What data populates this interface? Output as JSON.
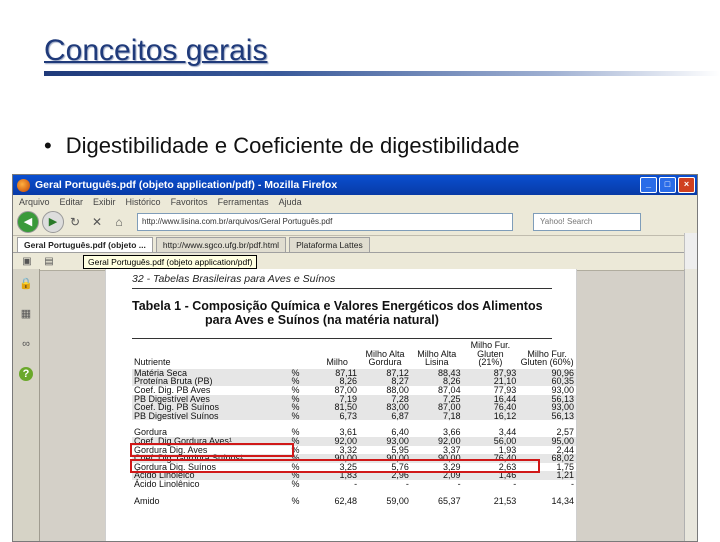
{
  "slide": {
    "title": "Conceitos gerais",
    "bullet": "Digestibilidade e Coeficiente de digestibilidade"
  },
  "browser": {
    "window_title": "Geral Português.pdf (objeto application/pdf) - Mozilla Firefox",
    "menu_items": [
      "Arquivo",
      "Editar",
      "Exibir",
      "Histórico",
      "Favoritos",
      "Ferramentas",
      "Ajuda"
    ],
    "url": "http://www.lisina.com.br/arquivos/Geral Português.pdf",
    "search_placeholder": "Yahoo! Search",
    "tabs": [
      {
        "label": "Geral Português.pdf (objeto ...",
        "active": true
      },
      {
        "label": "http://www.sgco.ufg.br/pdf.html",
        "active": false
      },
      {
        "label": "Plataforma Lattes",
        "active": false
      }
    ],
    "tooltip": "Geral Português.pdf (objeto application/pdf)"
  },
  "pdf": {
    "page_header": "32   -   Tabelas Brasileiras para Aves e Suínos",
    "caption_line1": "Tabela 1 -   Composição Química e Valores Energéticos dos Alimentos",
    "caption_line2": "para Aves e Suínos (na matéria natural)",
    "columns": [
      "Nutriente",
      "",
      "Milho",
      "Milho Alta Gordura",
      "Milho Alta Lisina",
      "Milho Fur. Gluten (21%)",
      "Milho Fur. Gluten (60%)"
    ],
    "rows": [
      {
        "name": "Matéria Seca",
        "unit": "%",
        "values": [
          "87,11",
          "87,12",
          "88,43",
          "87,93",
          "90,96"
        ],
        "shade": true
      },
      {
        "name": "Proteína Bruta (PB)",
        "unit": "%",
        "values": [
          "8,26",
          "8,27",
          "8,26",
          "21,10",
          "60,35"
        ],
        "shade": true
      },
      {
        "name": "Coef. Dig. PB Aves",
        "unit": "%",
        "values": [
          "87,00",
          "88,00",
          "87,04",
          "77,93",
          "93,00"
        ],
        "shade": false
      },
      {
        "name": "PB Digestível Aves",
        "unit": "%",
        "values": [
          "7,19",
          "7,28",
          "7,25",
          "16,44",
          "56,13"
        ],
        "shade": true
      },
      {
        "name": "Coef. Dig. PB Suínos",
        "unit": "%",
        "values": [
          "81,50",
          "83,00",
          "87,00",
          "76,40",
          "93,00"
        ],
        "shade": true
      },
      {
        "name": "PB Digestível Suínos",
        "unit": "%",
        "values": [
          "6,73",
          "6,87",
          "7,18",
          "16,12",
          "56,13"
        ],
        "shade": true
      },
      {
        "name": "",
        "unit": "",
        "values": [
          "",
          "",
          "",
          "",
          ""
        ],
        "shade": false,
        "gap": true
      },
      {
        "name": "Gordura",
        "unit": "%",
        "values": [
          "3,61",
          "6,40",
          "3,66",
          "3,44",
          "2,57"
        ],
        "shade": false
      },
      {
        "name": "Coef. Dig Gordura Aves¹",
        "unit": "%",
        "values": [
          "92,00",
          "93,00",
          "92,00",
          "56,00",
          "95,00"
        ],
        "shade": true
      },
      {
        "name": "Gordura Dig. Aves",
        "unit": "%",
        "values": [
          "3,32",
          "5,95",
          "3,37",
          "1,93",
          "2,44"
        ],
        "shade": false
      },
      {
        "name": "Coef. Dig. Gordura Suínos¹",
        "unit": "%",
        "values": [
          "90,00",
          "90,00",
          "90,00",
          "76,40",
          "68,02"
        ],
        "shade": true
      },
      {
        "name": "Gordura Dig. Suínos",
        "unit": "%",
        "values": [
          "3,25",
          "5,76",
          "3,29",
          "2,63",
          "1,75"
        ],
        "shade": false
      },
      {
        "name": "Ácido Linoléico",
        "unit": "%",
        "values": [
          "1,83",
          "2,96",
          "2,09",
          "1,46",
          "1,21"
        ],
        "shade": true
      },
      {
        "name": "Ácido Linolênico",
        "unit": "%",
        "values": [
          "-",
          "-",
          "-",
          "-",
          "-"
        ],
        "shade": false
      },
      {
        "name": "",
        "unit": "",
        "values": [
          "",
          "",
          "",
          "",
          ""
        ],
        "shade": false,
        "gap": true
      },
      {
        "name": "Amido",
        "unit": "%",
        "values": [
          "62,48",
          "59,00",
          "65,37",
          "21,53",
          "14,34"
        ],
        "shade": false
      }
    ]
  },
  "colors": {
    "title": "#1f3a7a",
    "highlight_box": "#d01818",
    "titlebar": "#0a4fd0"
  }
}
